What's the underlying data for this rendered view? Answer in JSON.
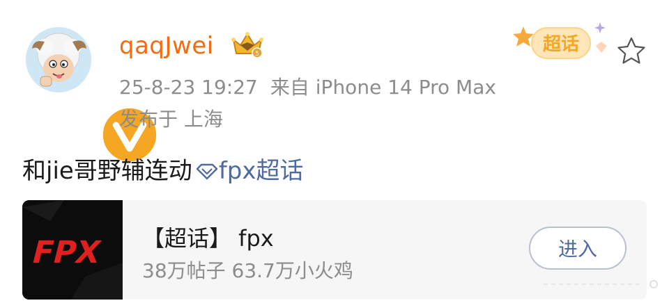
{
  "author": {
    "username": "qaqJwei",
    "verified": true,
    "avatar": "pleasant-goat-slow-goat-avatar",
    "badge": "crown-level-badge"
  },
  "meta": {
    "timestamp": "25-8-23 19:27",
    "source": "来自 iPhone 14 Pro Max",
    "location": "发布于 上海"
  },
  "badges": {
    "supertopic_label": "超话"
  },
  "post": {
    "text": "和jie哥野辅连动",
    "topic_link": "fpx超话"
  },
  "topic_card": {
    "title": "【超话】 fpx",
    "stats": "38万帖子 63.7万小火鸡",
    "button_label": "进入",
    "logo_text": "FPX"
  },
  "colors": {
    "username": "#f56c0f",
    "link": "#4f6aa1",
    "meta": "#8c8c8c",
    "card_bg": "#f6f6f6"
  }
}
